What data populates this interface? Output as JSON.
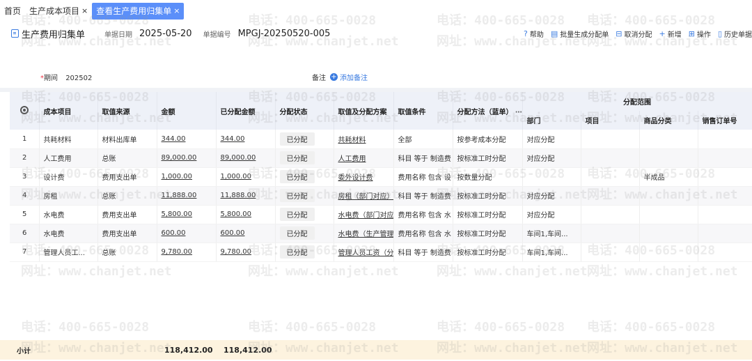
{
  "tabs": [
    {
      "label": "首页",
      "active": false,
      "closable": false
    },
    {
      "label": "生产成本项目",
      "active": false,
      "closable": true
    },
    {
      "label": "查看生产费用归集单",
      "active": true,
      "closable": true
    }
  ],
  "header": {
    "title": "生产费用归集单",
    "date_label": "单据日期",
    "date_value": "2025-05-20",
    "number_label": "单据编号",
    "number_value": "MPGJ-20250520-005"
  },
  "toolbar": [
    {
      "label": "帮助",
      "icon": "help-icon",
      "glyph": "?"
    },
    {
      "label": "批量生成分配单",
      "icon": "batch-icon",
      "glyph": "▤"
    },
    {
      "label": "取消分配",
      "icon": "cancel-icon",
      "glyph": "⊟"
    },
    {
      "label": "新增",
      "icon": "plus-icon",
      "glyph": "+"
    },
    {
      "label": "操作",
      "icon": "grid-icon",
      "glyph": "⊞"
    },
    {
      "label": "历史单据",
      "icon": "history-icon",
      "glyph": "▯"
    }
  ],
  "form": {
    "period_label": "期间",
    "period_value": "202502",
    "remark_label": "备注",
    "add_remark": "添加备注"
  },
  "table": {
    "columns": [
      "",
      "成本项目",
      "取值来源",
      "金额",
      "已分配金额",
      "分配状态",
      "取值及分配方案",
      "取值条件",
      "分配方法（蓝单）",
      "部门",
      "项目",
      "商品分类",
      "销售订单号"
    ],
    "group_header": "分配范围",
    "ellipsis": "⋯",
    "rows": [
      [
        "1",
        "共耗材料",
        "材料出库单",
        "344.00",
        "344.00",
        "已分配",
        "共耗材料",
        "全部",
        "按参考成本分配",
        "对应分配",
        "",
        "",
        ""
      ],
      [
        "2",
        "人工费用",
        "总账",
        "89,000.00",
        "89,000.00",
        "已分配",
        "人工费用",
        "科目 等于 制造费",
        "按标准工时分配",
        "对应分配",
        "",
        "",
        ""
      ],
      [
        "3",
        "设计费",
        "费用支出单",
        "1,000.00",
        "1,000.00",
        "已分配",
        "委外设计费",
        "费用名称 包含 设",
        "按数量分配",
        "",
        "",
        "半成品",
        ""
      ],
      [
        "4",
        "房租",
        "总账",
        "11,888.00",
        "11,888.00",
        "已分配",
        "房租（部门对应）",
        "科目 等于 制造费",
        "按标准工时分配",
        "对应分配",
        "",
        "",
        ""
      ],
      [
        "5",
        "水电费",
        "费用支出单",
        "5,800.00",
        "5,800.00",
        "已分配",
        "水电费（部门对应）",
        "费用名称 包含 水",
        "按标准工时分配",
        "对应分配",
        "",
        "",
        ""
      ],
      [
        "6",
        "水电费",
        "费用支出单",
        "600.00",
        "600.00",
        "已分配",
        "水电费（生产管理）",
        "费用名称 包含 水",
        "按标准工时分配",
        "车间1,车间...",
        "",
        "",
        ""
      ],
      [
        "7",
        "管理人员工...",
        "总账",
        "9,780.00",
        "9,780.00",
        "已分配",
        "管理人员工资（分）",
        "科目 等于 制造费",
        "按标准工时分配",
        "车间1,车间...",
        "",
        "",
        ""
      ]
    ]
  },
  "subtotal": {
    "label": "小计",
    "amount": "118,412.00",
    "allocated": "118,412.00"
  },
  "watermark": {
    "phone": "电话：400-665-0028",
    "site": "网址：www.chanjet.net"
  }
}
